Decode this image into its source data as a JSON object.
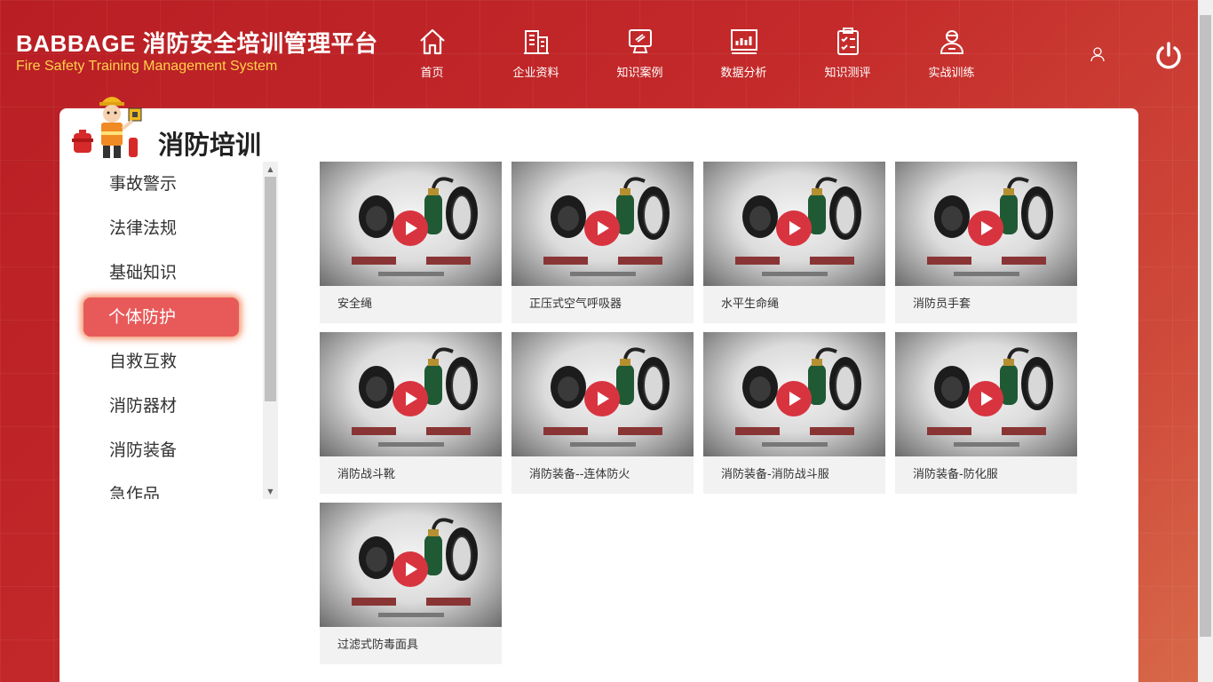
{
  "brand": {
    "title": "BABBAGE 消防安全培训管理平台",
    "subtitle": "Fire Safety Training Management System"
  },
  "nav": [
    {
      "label": "首页",
      "icon": "home-icon"
    },
    {
      "label": "企业资料",
      "icon": "building-icon"
    },
    {
      "label": "知识案例",
      "icon": "monitor-icon"
    },
    {
      "label": "数据分析",
      "icon": "chart-icon"
    },
    {
      "label": "知识测评",
      "icon": "checklist-icon"
    },
    {
      "label": "实战训练",
      "icon": "trainer-icon"
    }
  ],
  "section_title": "消防培训",
  "sidebar": {
    "items": [
      {
        "label": "事故警示"
      },
      {
        "label": "法律法规"
      },
      {
        "label": "基础知识"
      },
      {
        "label": "个体防护",
        "active": true
      },
      {
        "label": "自救互救"
      },
      {
        "label": "消防器材"
      },
      {
        "label": "消防装备"
      },
      {
        "label": "急作品"
      }
    ]
  },
  "videos": [
    {
      "title": "安全绳"
    },
    {
      "title": "正压式空气呼吸器"
    },
    {
      "title": "水平生命绳"
    },
    {
      "title": "消防员手套"
    },
    {
      "title": "消防战斗靴"
    },
    {
      "title": "消防装备--连体防火"
    },
    {
      "title": "消防装备-消防战斗服"
    },
    {
      "title": "消防装备-防化服"
    },
    {
      "title": "过滤式防毒面具"
    }
  ],
  "colors": {
    "brand_red": "#c42a2a",
    "subtitle_yellow": "#ffd24a",
    "active_item": "#e85a5a",
    "play_button": "#d8343f"
  }
}
